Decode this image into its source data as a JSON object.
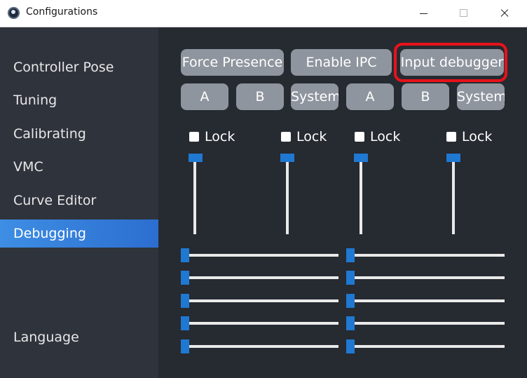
{
  "window": {
    "title": "Configurations"
  },
  "sidebar": {
    "items": [
      {
        "label": "Controller Pose"
      },
      {
        "label": "Tuning"
      },
      {
        "label": "Calibrating"
      },
      {
        "label": "VMC"
      },
      {
        "label": "Curve Editor"
      },
      {
        "label": "Debugging",
        "active": true
      },
      {
        "label": "Language"
      }
    ]
  },
  "debugging": {
    "top_buttons": [
      {
        "label": "Force Presence"
      },
      {
        "label": "Enable IPC"
      },
      {
        "label": "Input debugger",
        "highlighted": true
      }
    ],
    "controller_buttons": [
      {
        "label": "A"
      },
      {
        "label": "B"
      },
      {
        "label": "System"
      },
      {
        "label": "A"
      },
      {
        "label": "B"
      },
      {
        "label": "System"
      }
    ],
    "locks": [
      {
        "label": "Lock",
        "checked": false
      },
      {
        "label": "Lock",
        "checked": false
      },
      {
        "label": "Lock",
        "checked": false
      },
      {
        "label": "Lock",
        "checked": false
      }
    ],
    "vertical_sliders": [
      {
        "value": 1.0
      },
      {
        "value": 1.0
      },
      {
        "value": 1.0
      },
      {
        "value": 1.0
      }
    ],
    "horizontal_sliders_left": [
      {
        "value": 0
      },
      {
        "value": 0
      },
      {
        "value": 0
      },
      {
        "value": 0
      },
      {
        "value": 0
      }
    ],
    "horizontal_sliders_right": [
      {
        "value": 0
      },
      {
        "value": 0
      },
      {
        "value": 0
      },
      {
        "value": 0
      },
      {
        "value": 0
      }
    ]
  },
  "colors": {
    "accent": "#2c6ed0",
    "button": "#8f959e",
    "highlight": "#e8121b",
    "slider_handle": "#1f78d1"
  }
}
